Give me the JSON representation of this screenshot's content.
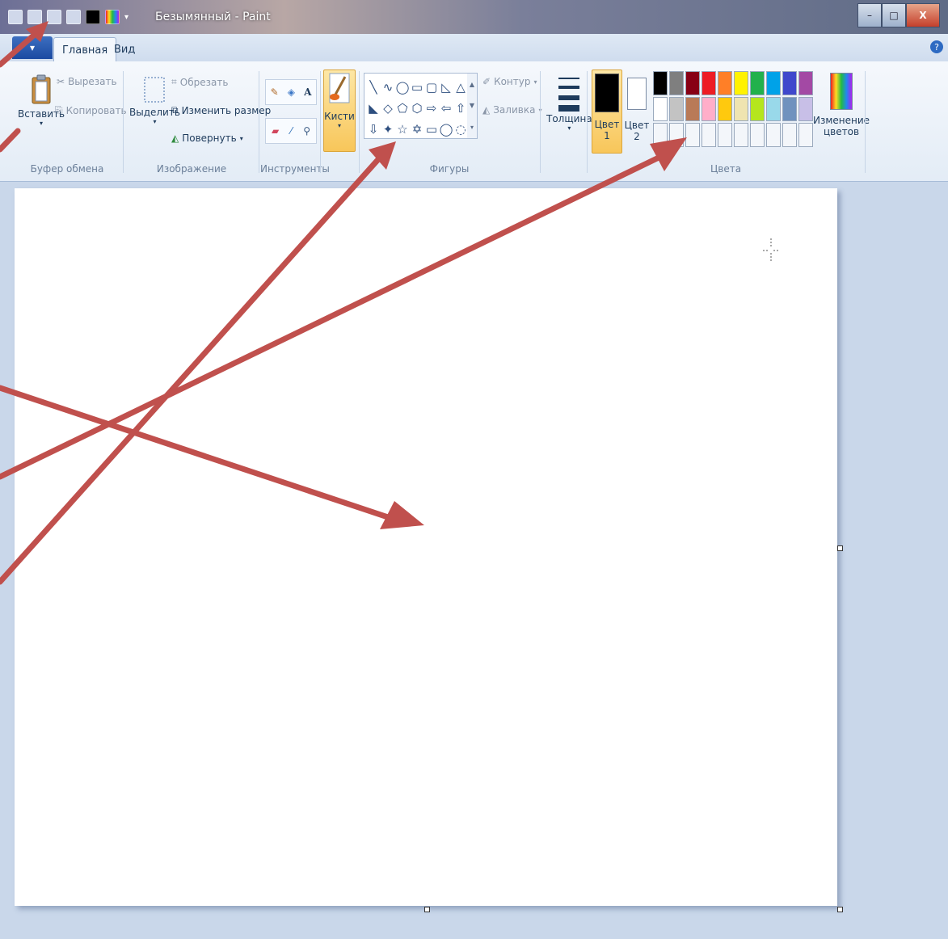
{
  "window": {
    "title": "Безымянный - Paint",
    "controls": {
      "minimize": "–",
      "maximize": "□",
      "close": "X"
    }
  },
  "qat": {
    "icons": [
      "paint-app-icon",
      "save-icon",
      "undo-icon",
      "redo-icon",
      "color1-swatch-icon",
      "color-picker-icon",
      "customize-dropdown-icon"
    ]
  },
  "tabs": {
    "file": "▾",
    "home": "Главная",
    "view": "Вид",
    "help": "?"
  },
  "ribbon": {
    "clipboard": {
      "paste": "Вставить",
      "cut": "Вырезать",
      "copy": "Копировать",
      "group_label": "Буфер обмена"
    },
    "image": {
      "select": "Выделить",
      "crop": "Обрезать",
      "resize": "Изменить размер",
      "rotate": "Повернуть",
      "group_label": "Изображение"
    },
    "tools": {
      "group_label": "Инструменты",
      "text_glyph": "A"
    },
    "brushes": {
      "label": "Кисти"
    },
    "shapes": {
      "outline": "Контур",
      "fill": "Заливка",
      "group_label": "Фигуры",
      "glyphs": [
        "╲",
        "∿",
        "◯",
        "▭",
        "▢",
        "◺",
        "△",
        "◣",
        "◇",
        "⬠",
        "⬡",
        "⇨",
        "⇦",
        "⇧",
        "⇩",
        "✦",
        "☆",
        "✡",
        "▭",
        "◯",
        "◌"
      ]
    },
    "size": {
      "label": "Толщина"
    },
    "colors": {
      "color1": "Цвет",
      "color1_num": "1",
      "color2": "Цвет",
      "color2_num": "2",
      "edit_colors_line1": "Изменение",
      "edit_colors_line2": "цветов",
      "group_label": "Цвета",
      "color1_value": "#000000",
      "color2_value": "#ffffff",
      "palette_row1": [
        "#000000",
        "#7f7f7f",
        "#880015",
        "#ed1c24",
        "#ff7f27",
        "#fff200",
        "#22b14c",
        "#00a2e8",
        "#3f48cc",
        "#a349a4"
      ],
      "palette_row2": [
        "#ffffff",
        "#c3c3c3",
        "#b97a57",
        "#ffaec9",
        "#ffc90e",
        "#efe4b0",
        "#b5e61d",
        "#99d9ea",
        "#7092be",
        "#c8bfe7"
      ]
    }
  },
  "annotation_color": "#c0504d"
}
